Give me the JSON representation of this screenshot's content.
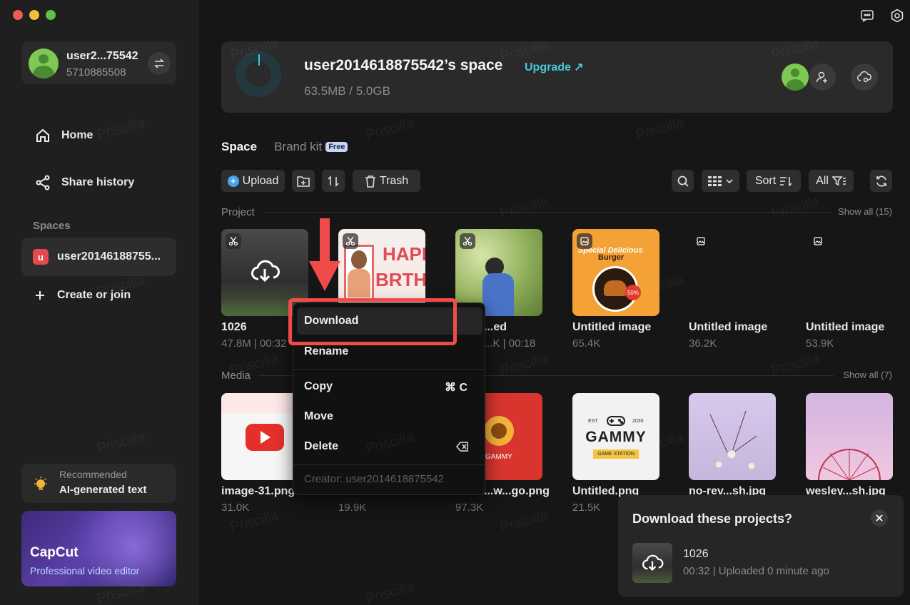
{
  "account": {
    "name": "user2...75542",
    "id": "5710885508"
  },
  "nav": {
    "home": "Home",
    "share_history": "Share history"
  },
  "spaces": {
    "section_title": "Spaces",
    "badge": "u",
    "current": "user20146188755...",
    "create": "Create or join"
  },
  "recommended": {
    "small": "Recommended",
    "title": "AI-generated text"
  },
  "promo": {
    "title": "CapCut",
    "subtitle": "Professional video editor"
  },
  "banner": {
    "title": "user2014618875542’s space",
    "upgrade": "Upgrade ↗",
    "storage": "63.5MB / 5.0GB",
    "storage_used_fraction": 0.0124
  },
  "tabs": {
    "space": "Space",
    "brand_kit": "Brand kit",
    "free_badge": "Free"
  },
  "toolbar": {
    "upload": "Upload",
    "trash": "Trash",
    "sort": "Sort",
    "all": "All"
  },
  "project": {
    "title": "Project",
    "show_all": "Show all (15)",
    "items": [
      {
        "name": "1026",
        "meta": "47.8M | 00:32"
      },
      {
        "name": "",
        "meta": ""
      },
      {
        "name": "...ed",
        "meta": "...K | 00:18"
      },
      {
        "name": "Untitled image",
        "meta": "65.4K"
      },
      {
        "name": "Untitled image",
        "meta": "36.2K"
      },
      {
        "name": "Untitled image",
        "meta": "53.9K"
      }
    ]
  },
  "media": {
    "title": "Media",
    "show_all": "Show all (7)",
    "items": [
      {
        "name": "image-31.png",
        "meta": "31.0K"
      },
      {
        "name": "",
        "meta": "19.9K"
      },
      {
        "name": "...w...go.png",
        "meta": "97.3K"
      },
      {
        "name": "Untitled.png",
        "meta": "21.5K"
      },
      {
        "name": "no-rev...sh.jpg",
        "meta": ""
      },
      {
        "name": "wesley...sh.jpg",
        "meta": ""
      }
    ]
  },
  "thumb_text": {
    "happy": "HAPP",
    "birth": "BRTH",
    "special": "Special Delicious",
    "burger": "Burger",
    "discount": "50%",
    "gammy": "GAMMY",
    "game_station": "GAME STATION",
    "est": "EST",
    "year": "2030"
  },
  "context_menu": {
    "download": "Download",
    "rename": "Rename",
    "copy": "Copy",
    "copy_shortcut": "⌘  C",
    "move": "Move",
    "delete": "Delete",
    "creator": "Creator: user2014618875542"
  },
  "toast": {
    "title": "Download these projects?",
    "name": "1026",
    "meta": "00:32 | Uploaded 0 minute ago"
  },
  "watermark": "Priscilla",
  "colors": {
    "accent": "#48c7d8",
    "highlight": "#f04b4b",
    "upload": "#4aa3f0"
  }
}
